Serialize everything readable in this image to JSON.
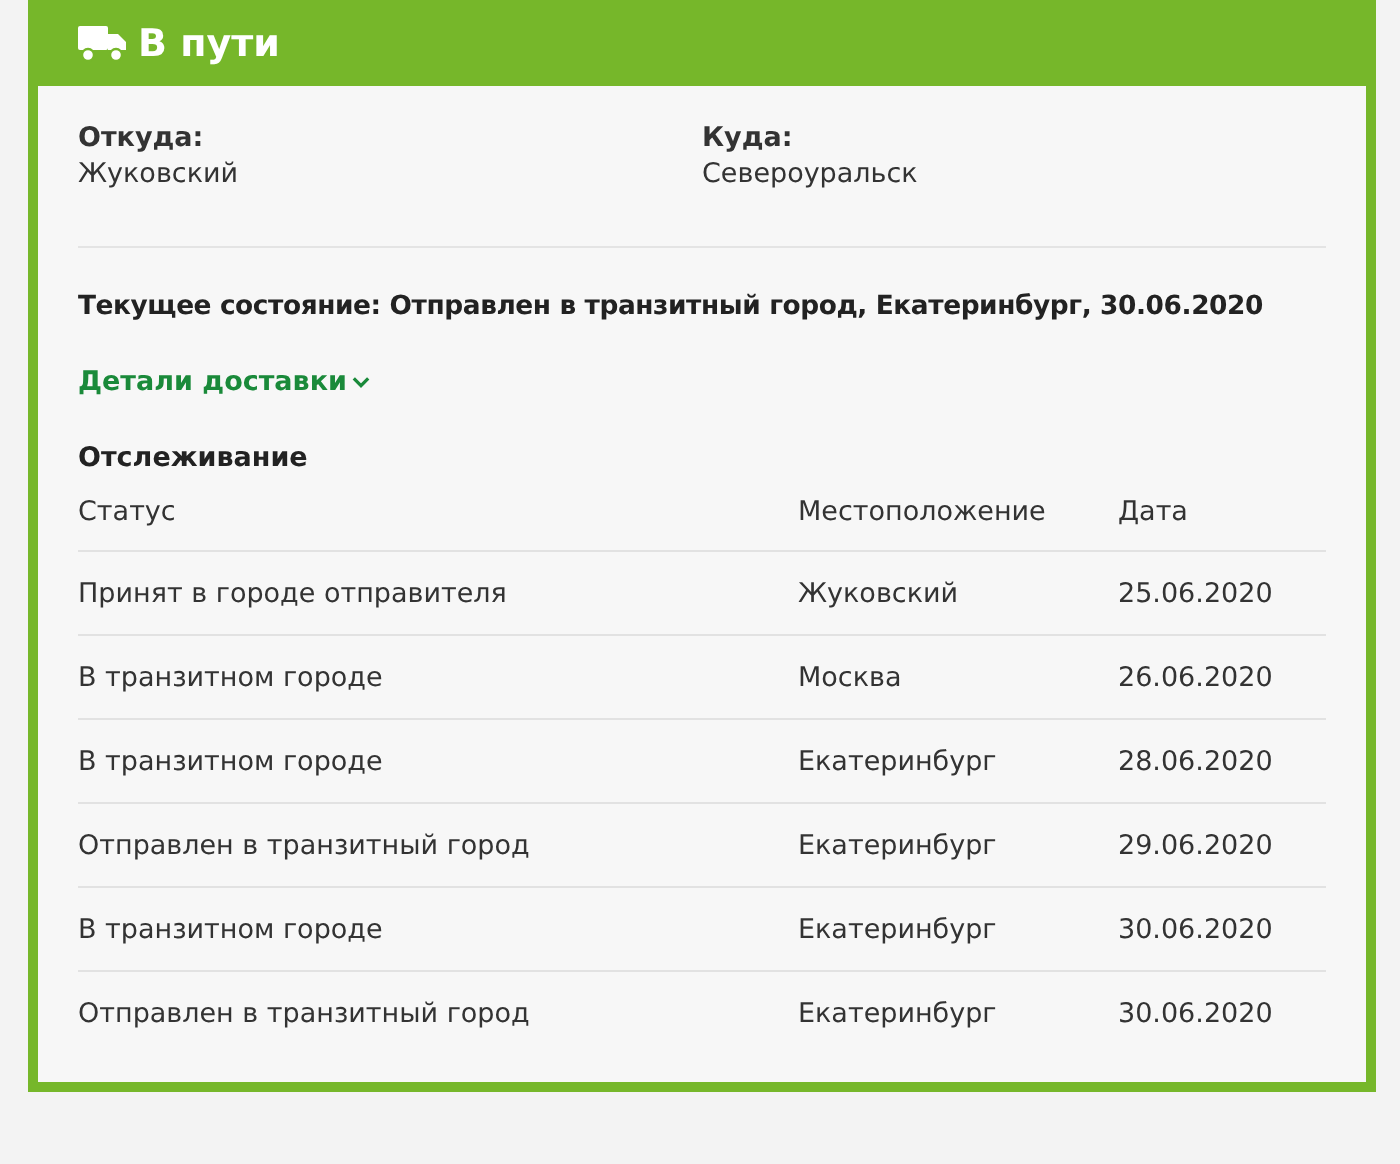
{
  "header": {
    "title": "В пути"
  },
  "from": {
    "label": "Откуда:",
    "value": "Жуковский"
  },
  "to": {
    "label": "Куда:",
    "value": "Североуральск"
  },
  "current_status": "Текущее состояние: Отправлен в транзитный город, Екатеринбург, 30.06.2020",
  "details_link": {
    "label": "Детали доставки",
    "expanded": false
  },
  "tracking": {
    "title": "Отслеживание",
    "columns": [
      "Статус",
      "Местоположение",
      "Дата"
    ],
    "rows": [
      [
        "Принят в городе отправителя",
        "Жуковский",
        "25.06.2020"
      ],
      [
        "В транзитном городе",
        "Москва",
        "26.06.2020"
      ],
      [
        "В транзитном городе",
        "Екатеринбург",
        "28.06.2020"
      ],
      [
        "Отправлен в транзитный город",
        "Екатеринбург",
        "29.06.2020"
      ],
      [
        "В транзитном городе",
        "Екатеринбург",
        "30.06.2020"
      ],
      [
        "Отправлен в транзитный город",
        "Екатеринбург",
        "30.06.2020"
      ]
    ]
  }
}
